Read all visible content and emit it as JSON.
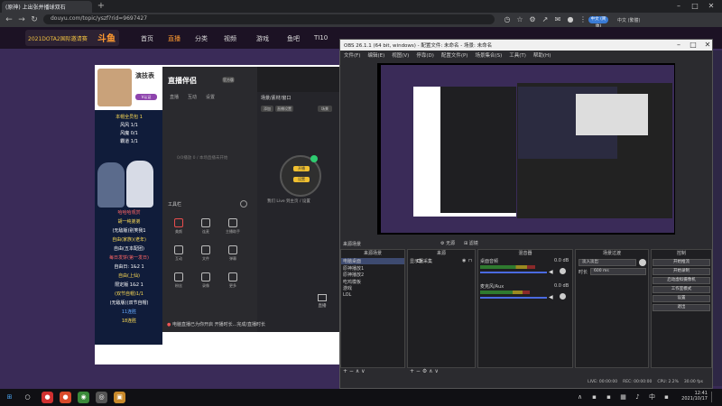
{
  "browser": {
    "tab_title": "(原神) 上出张并播球双石",
    "url": "douyu.com/topic/yszf?rid=9697427",
    "account_chip": "中文 (简体)",
    "lang_label": "中文 (繁體)"
  },
  "site": {
    "logo_text": "2021DOTA2国际邀请赛",
    "brand": "斗鱼",
    "nav": [
      "首页",
      "直播",
      "分类",
      "视频",
      "游戏",
      "鱼吧",
      "TI10"
    ],
    "nav_active_index": 1
  },
  "streamer": {
    "name": "演技表",
    "badge": "V认证",
    "poster_lines": [
      "本帽全员包 1",
      "风风 1/1",
      "风魔 0/1",
      "霸道 1/1",
      "哈哈哈观赏",
      "胡一纯弟弟",
      "(无敌版)别笑我1",
      "自由(家族)(老年)",
      "自由(五本配团)",
      "每日发饼(第一发日)",
      "自由日: 1&2 1",
      "自由(上仙)",
      "限定版 1&2 1",
      "(双节自帽)1/1",
      "(无敌版)(双节自帽)",
      "11连胜",
      "18连胜"
    ]
  },
  "live_app": {
    "logo": "直播伴侣",
    "version": "官方版",
    "tabs": [
      "直播",
      "互动",
      "设置"
    ],
    "hint_line": "0/0播放 0 / 本场直播未开始",
    "tools_title": "工具栏",
    "tools": [
      "美颜",
      "连麦",
      "主播助手",
      "互动",
      "文件",
      "弹幕",
      "粉丝",
      "录像",
      "更多"
    ],
    "scene_title": "场景/素材/窗口",
    "scene_buttons": [
      "添加",
      "直播设置",
      "场景"
    ],
    "orb_buttons": [
      "开播",
      "设置"
    ],
    "orb_hint": "我们 Live 到主页 / 设置",
    "live_label": "直播",
    "bottom_text": "电脑直播已为你开启",
    "bottom_tail": "开播时长...完成/直播时长"
  },
  "obs": {
    "title": "OBS 26.1.1 (64 bit, windows) - 配置文件: 未命名 - 场景: 未命名",
    "menu": [
      "文件(F)",
      "编辑(E)",
      "视图(V)",
      "停靠(D)",
      "配置文件(P)",
      "场景集合(S)",
      "工具(T)",
      "帮助(H)"
    ],
    "no_source_label": "无源",
    "filters_label": "滤镜",
    "scenes_title": "来源场景",
    "scenes": [
      "电脑桌面",
      "原神播放1",
      "原神播放2",
      "吃鸡模板",
      "游戏",
      "LOL"
    ],
    "sources_title": "来源",
    "sources": [
      "显示器采集"
    ],
    "mixer_title": "混音器",
    "mixer": [
      {
        "name": "桌面音频",
        "db": "0.0 dB",
        "level": 0.78
      },
      {
        "name": "麦克风/Aux",
        "db": "0.0 dB",
        "level": 0.7
      }
    ],
    "transitions_title": "场景过渡",
    "transition": "淡入淡出",
    "duration_label": "时长",
    "duration_value": "600 ms",
    "controls_title": "控制",
    "controls": [
      "开始推流",
      "开始录制",
      "启动虚拟摄像机",
      "工作室模式",
      "设置",
      "退出"
    ],
    "status": [
      "LIVE: 00:00:00",
      "REC: 00:00:00",
      "CPU: 2.2%",
      "30.00 fps"
    ]
  },
  "taskbar": {
    "time": "12:41",
    "date": "2021/10/17"
  }
}
